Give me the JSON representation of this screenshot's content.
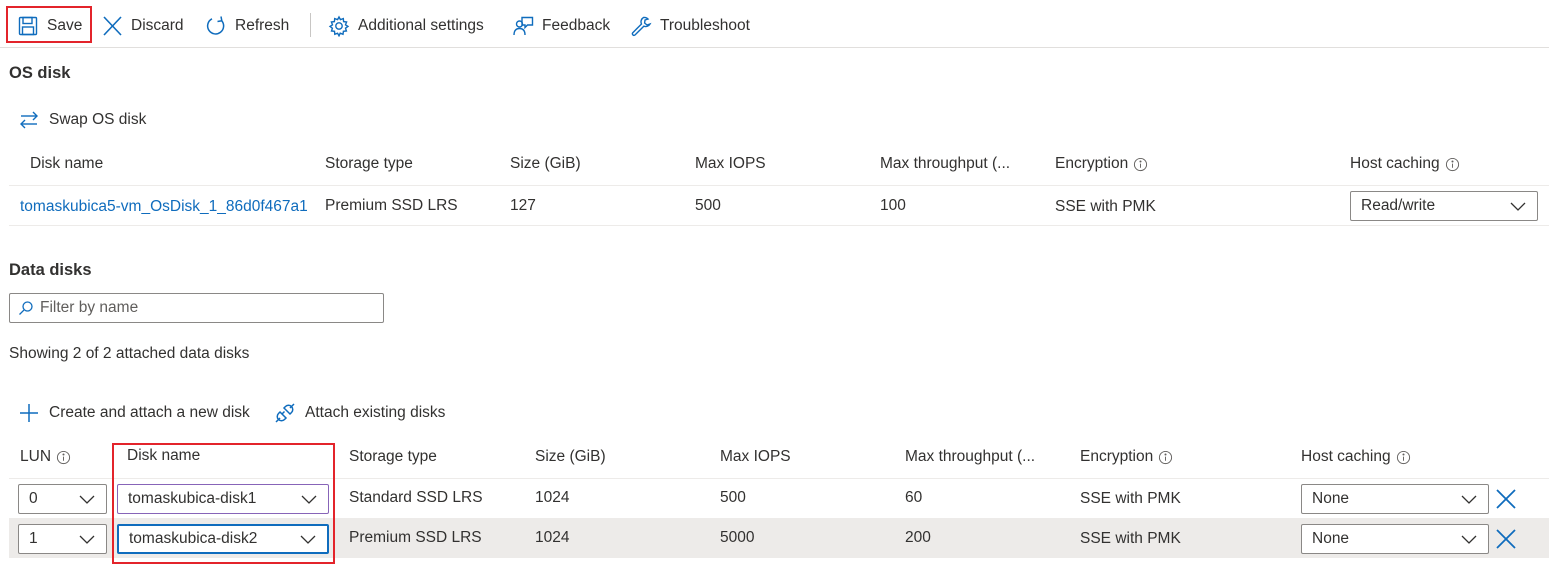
{
  "toolbar": {
    "save": "Save",
    "discard": "Discard",
    "refresh": "Refresh",
    "additional_settings": "Additional settings",
    "feedback": "Feedback",
    "troubleshoot": "Troubleshoot"
  },
  "os_disk": {
    "title": "OS disk",
    "swap_label": "Swap OS disk",
    "columns": [
      "Disk name",
      "Storage type",
      "Size (GiB)",
      "Max IOPS",
      "Max throughput (...",
      "Encryption",
      "Host caching"
    ],
    "row": {
      "disk_name": "tomaskubica5-vm_OsDisk_1_86d0f467a1",
      "storage_type": "Premium SSD LRS",
      "size": "127",
      "max_iops": "500",
      "max_throughput": "100",
      "encryption": "SSE with PMK",
      "host_caching": "Read/write"
    }
  },
  "data_disks": {
    "title": "Data disks",
    "filter_placeholder": "Filter by name",
    "showing_text": "Showing 2 of 2 attached data disks",
    "create_label": "Create and attach a new disk",
    "attach_label": "Attach existing disks",
    "columns": [
      "LUN",
      "Disk name",
      "Storage type",
      "Size (GiB)",
      "Max IOPS",
      "Max throughput (...",
      "Encryption",
      "Host caching"
    ],
    "rows": [
      {
        "lun": "0",
        "disk_name": "tomaskubica-disk1",
        "storage_type": "Standard SSD LRS",
        "size": "1024",
        "max_iops": "500",
        "max_throughput": "60",
        "encryption": "SSE with PMK",
        "host_caching": "None"
      },
      {
        "lun": "1",
        "disk_name": "tomaskubica-disk2",
        "storage_type": "Premium SSD LRS",
        "size": "1024",
        "max_iops": "5000",
        "max_throughput": "200",
        "encryption": "SSE with PMK",
        "host_caching": "None"
      }
    ]
  },
  "colors": {
    "accent": "#0f6cbd",
    "highlight": "#e3242b",
    "text": "#323130"
  },
  "icons": [
    "save-icon",
    "discard-icon",
    "refresh-icon",
    "gear-icon",
    "feedback-icon",
    "wrench-icon",
    "swap-icon",
    "info-icon",
    "chevron-down-icon",
    "search-icon",
    "plus-icon",
    "attach-icon",
    "delete-icon"
  ]
}
